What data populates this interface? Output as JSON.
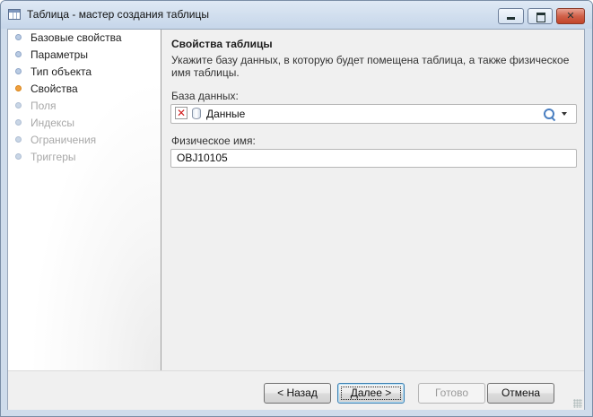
{
  "window": {
    "title": "Таблица - мастер создания таблицы"
  },
  "nav": {
    "items": [
      {
        "label": "Базовые свойства",
        "state": "done"
      },
      {
        "label": "Параметры",
        "state": "done"
      },
      {
        "label": "Тип объекта",
        "state": "done"
      },
      {
        "label": "Свойства",
        "state": "current"
      },
      {
        "label": "Поля",
        "state": "pending"
      },
      {
        "label": "Индексы",
        "state": "pending"
      },
      {
        "label": "Ограничения",
        "state": "pending"
      },
      {
        "label": "Триггеры",
        "state": "pending"
      }
    ]
  },
  "content": {
    "title": "Свойства таблицы",
    "description": "Укажите базу данных, в которую будет помещена таблица, а также физическое имя таблицы.",
    "database_label": "База данных:",
    "database_value": "Данные",
    "physical_name_label": "Физическое имя:",
    "physical_name_value": "OBJ10105"
  },
  "buttons": {
    "back": "< Назад",
    "next": "Далее >",
    "finish": "Готово",
    "cancel": "Отмена"
  },
  "colors": {
    "current_step": "#f0a040",
    "close_button": "#c24429"
  }
}
